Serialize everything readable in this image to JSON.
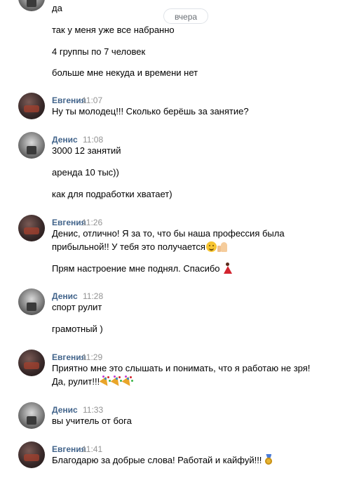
{
  "date_divider": "вчера",
  "messages": [
    {
      "lines": [
        "да",
        "так у меня уже все набранно",
        "4 группы по 7 человек",
        "больше мне некуда и времени нет"
      ]
    },
    {
      "author": "Евгения",
      "time": "11:07",
      "lines": [
        "Ну ты молодец!!! Сколько берёшь за занятие?"
      ]
    },
    {
      "author": "Денис",
      "time": "11:08",
      "lines": [
        "3000 12 занятий",
        "аренда 10 тыс))",
        "как для подработки хватает)"
      ]
    },
    {
      "author": "Евгения",
      "time": "11:26",
      "lines": [
        "Денис, отлично! Я за то, что бы наша профессия была",
        "прибыльной!! У тебя это получается",
        "Прям настроение мне поднял. Спасибо"
      ]
    },
    {
      "author": "Денис",
      "time": "11:28",
      "lines": [
        "спорт рулит",
        "грамотный )"
      ]
    },
    {
      "author": "Евгения",
      "time": "11:29",
      "lines": [
        "Приятно мне это слышать и понимать, что я работаю не зря!",
        "Да, рулит!!!"
      ]
    },
    {
      "author": "Денис",
      "time": "11:33",
      "lines": [
        "вы учитель от бога"
      ]
    },
    {
      "author": "Евгения",
      "time": "11:41",
      "lines": [
        "Благодарю за добрые слова! Работай и кайфуй!!!"
      ]
    }
  ],
  "emoji_names": {
    "smile": "smiling-face-emoji",
    "thumb": "thumbs-up-emoji",
    "dancer": "dancer-emoji",
    "party": "party-popper-emoji",
    "medal": "medal-emoji"
  },
  "colors": {
    "author_name": "#42648b",
    "timestamp": "#939393",
    "text": "#000000",
    "background": "#ffffff"
  }
}
